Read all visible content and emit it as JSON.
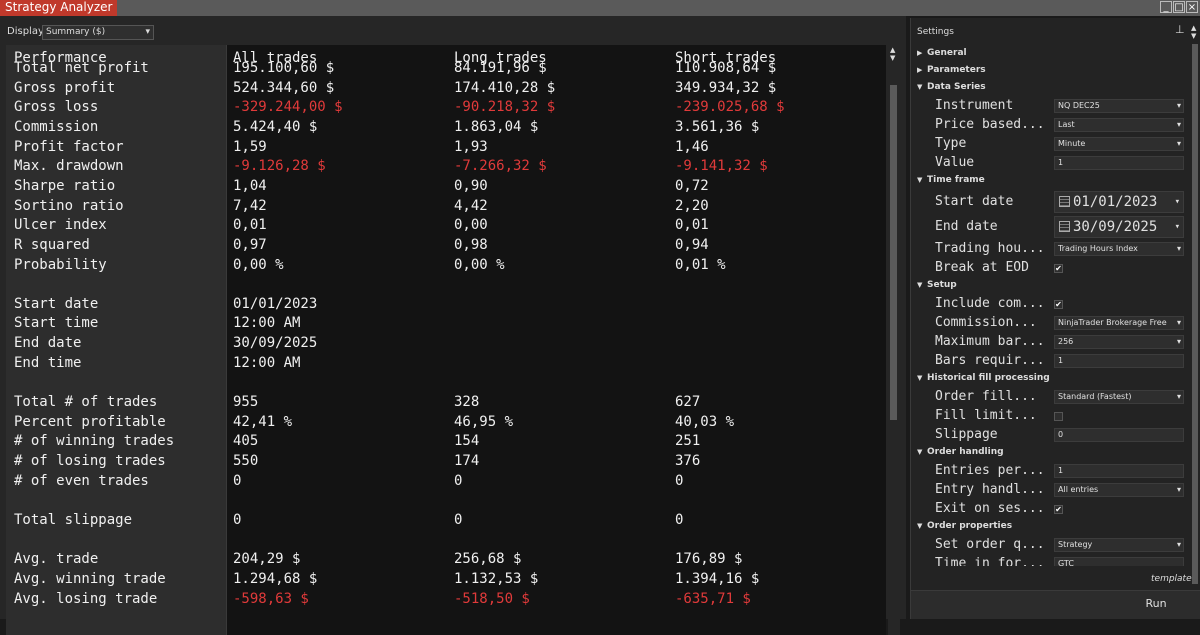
{
  "window": {
    "title": "Strategy Analyzer",
    "buttons": [
      "_",
      "□",
      "×"
    ]
  },
  "display": {
    "label": "Display",
    "value": "Summary ($)"
  },
  "columns": [
    "Performance",
    "All trades",
    "Long trades",
    "Short trades"
  ],
  "rows": [
    {
      "label": "Total net profit",
      "values": [
        "195.100,60 $",
        "84.191,96 $",
        "110.908,64 $"
      ],
      "negative": false
    },
    {
      "label": "Gross profit",
      "values": [
        "524.344,60 $",
        "174.410,28 $",
        "349.934,32 $"
      ],
      "negative": false
    },
    {
      "label": "Gross loss",
      "values": [
        "-329.244,00 $",
        "-90.218,32 $",
        "-239.025,68 $"
      ],
      "negative": true
    },
    {
      "label": "Commission",
      "values": [
        "5.424,40 $",
        "1.863,04 $",
        "3.561,36 $"
      ],
      "negative": false
    },
    {
      "label": "Profit factor",
      "values": [
        "1,59",
        "1,93",
        "1,46"
      ],
      "negative": false
    },
    {
      "label": "Max. drawdown",
      "values": [
        "-9.126,28 $",
        "-7.266,32 $",
        "-9.141,32 $"
      ],
      "negative": true
    },
    {
      "label": "Sharpe ratio",
      "values": [
        "1,04",
        "0,90",
        "0,72"
      ],
      "negative": false
    },
    {
      "label": "Sortino ratio",
      "values": [
        "7,42",
        "4,42",
        "2,20"
      ],
      "negative": false
    },
    {
      "label": "Ulcer index",
      "values": [
        "0,01",
        "0,00",
        "0,01"
      ],
      "negative": false
    },
    {
      "label": "R squared",
      "values": [
        "0,97",
        "0,98",
        "0,94"
      ],
      "negative": false
    },
    {
      "label": "Probability",
      "values": [
        "0,00 %",
        "0,00 %",
        "0,01 %"
      ],
      "negative": false
    },
    {
      "label": "",
      "values": [
        "",
        "",
        ""
      ],
      "negative": false
    },
    {
      "label": "Start date",
      "values": [
        "01/01/2023",
        "",
        ""
      ],
      "negative": false
    },
    {
      "label": "Start time",
      "values": [
        "12:00 AM",
        "",
        ""
      ],
      "negative": false
    },
    {
      "label": "End date",
      "values": [
        "30/09/2025",
        "",
        ""
      ],
      "negative": false
    },
    {
      "label": "End time",
      "values": [
        "12:00 AM",
        "",
        ""
      ],
      "negative": false
    },
    {
      "label": "",
      "values": [
        "",
        "",
        ""
      ],
      "negative": false
    },
    {
      "label": "Total # of trades",
      "values": [
        "955",
        "328",
        "627"
      ],
      "negative": false
    },
    {
      "label": "Percent profitable",
      "values": [
        "42,41 %",
        "46,95 %",
        "40,03 %"
      ],
      "negative": false
    },
    {
      "label": "# of winning trades",
      "values": [
        "405",
        "154",
        "251"
      ],
      "negative": false
    },
    {
      "label": "# of losing trades",
      "values": [
        "550",
        "174",
        "376"
      ],
      "negative": false
    },
    {
      "label": "# of even trades",
      "values": [
        "0",
        "0",
        "0"
      ],
      "negative": false
    },
    {
      "label": "",
      "values": [
        "",
        "",
        ""
      ],
      "negative": false
    },
    {
      "label": "Total slippage",
      "values": [
        "0",
        "0",
        "0"
      ],
      "negative": false
    },
    {
      "label": "",
      "values": [
        "",
        "",
        ""
      ],
      "negative": false
    },
    {
      "label": "Avg. trade",
      "values": [
        "204,29 $",
        "256,68 $",
        "176,89 $"
      ],
      "negative": false
    },
    {
      "label": "Avg. winning trade",
      "values": [
        "1.294,68 $",
        "1.132,53 $",
        "1.394,16 $"
      ],
      "negative": false
    },
    {
      "label": "Avg. losing trade",
      "values": [
        "-598,63 $",
        "-518,50 $",
        "-635,71 $"
      ],
      "negative": true
    }
  ],
  "settings": {
    "title": "Settings",
    "template_label": "template",
    "run_label": "Run",
    "sections": {
      "general": "General",
      "parameters": "Parameters",
      "data_series": "Data Series",
      "time_frame": "Time frame",
      "setup": "Setup",
      "historical_fill": "Historical fill processing",
      "order_handling": "Order handling",
      "order_properties": "Order properties"
    },
    "props": {
      "instrument": {
        "label": "Instrument",
        "value": "NQ DEC25"
      },
      "price_based": {
        "label": "Price based...",
        "value": "Last"
      },
      "type": {
        "label": "Type",
        "value": "Minute"
      },
      "value": {
        "label": "Value",
        "value": "1"
      },
      "start_date": {
        "label": "Start date",
        "value": "01/01/2023"
      },
      "end_date": {
        "label": "End date",
        "value": "30/09/2025"
      },
      "trading_hours": {
        "label": "Trading hou...",
        "value": "Trading Hours Index"
      },
      "break_eod": {
        "label": "Break at EOD",
        "value": "✔"
      },
      "include_com": {
        "label": "Include com...",
        "value": "✔"
      },
      "commission": {
        "label": "Commission...",
        "value": "NinjaTrader Brokerage Free"
      },
      "max_bars": {
        "label": "Maximum bar...",
        "value": "256"
      },
      "bars_required": {
        "label": "Bars requir...",
        "value": "1"
      },
      "order_fill": {
        "label": "Order fill...",
        "value": "Standard (Fastest)"
      },
      "fill_limit": {
        "label": "Fill limit...",
        "value": ""
      },
      "slippage": {
        "label": "Slippage",
        "value": "0"
      },
      "entries_per": {
        "label": "Entries per...",
        "value": "1"
      },
      "entry_handling": {
        "label": "Entry handl...",
        "value": "All entries"
      },
      "exit_session": {
        "label": "Exit on ses...",
        "value": "✔"
      },
      "set_order_q": {
        "label": "Set order q...",
        "value": "Strategy"
      },
      "time_in_force": {
        "label": "Time in for...",
        "value": "GTC"
      }
    }
  }
}
